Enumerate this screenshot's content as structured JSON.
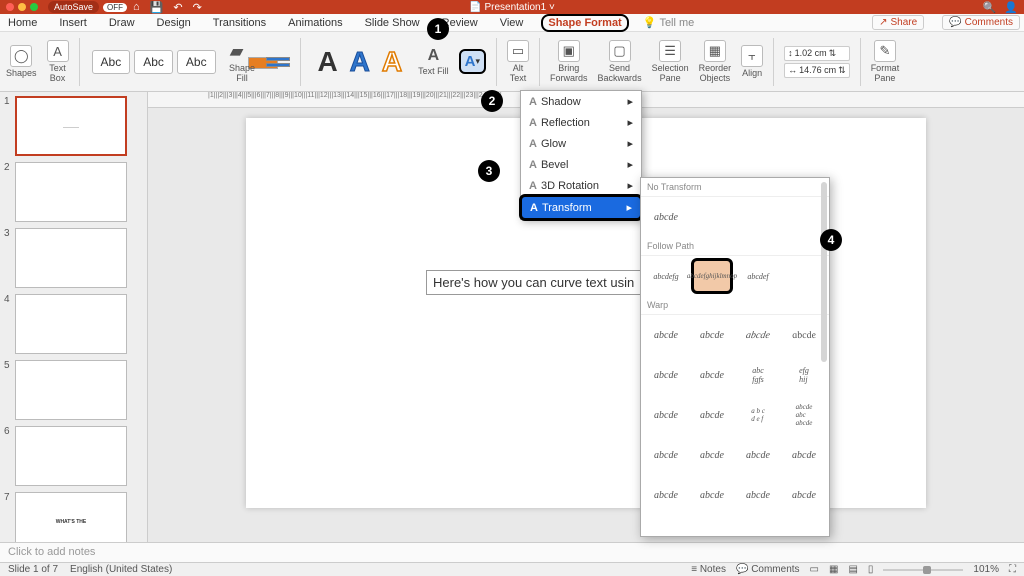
{
  "titlebar": {
    "autosave": "AutoSave",
    "off": "OFF",
    "doc": "Presentation1"
  },
  "tabs": {
    "items": [
      "Home",
      "Insert",
      "Draw",
      "Design",
      "Transitions",
      "Animations",
      "Slide Show",
      "Review",
      "View",
      "Shape Format"
    ],
    "active": "Shape Format",
    "tellme": "Tell me",
    "share": "Share",
    "comments": "Comments"
  },
  "ribbon": {
    "shapes": "Shapes",
    "textbox": "Text\nBox",
    "abc": "Abc",
    "shapefill": "Shape\nFill",
    "textfill": "Text Fill",
    "alttext": "Alt\nText",
    "bringfwd": "Bring\nForwards",
    "sendback": "Send\nBackwards",
    "selpane": "Selection\nPane",
    "reorder": "Reorder\nObjects",
    "align": "Align",
    "width": "1.02 cm",
    "height": "14.76 cm",
    "formatpane": "Format\nPane"
  },
  "dropdown": {
    "items": [
      "Shadow",
      "Reflection",
      "Glow",
      "Bevel",
      "3D Rotation",
      "Transform"
    ],
    "selected": "Transform"
  },
  "gallery": {
    "sections": {
      "notransform": "No Transform",
      "abcde": "abcde",
      "followpath": "Follow Path",
      "warp": "Warp"
    },
    "celltext": "abcde"
  },
  "slide": {
    "textbox": "Here's how you can curve text usin"
  },
  "notes": "Click to add notes",
  "status": {
    "left": "Slide 1 of 7",
    "lang": "English (United States)",
    "notes": "Notes",
    "comments": "Comments",
    "zoom": "101%"
  },
  "thumbs": {
    "count": 7,
    "last_preview": "WHAT'S THE"
  },
  "annotations": {
    "b1": "1",
    "b2": "2",
    "b3": "3",
    "b4": "4"
  }
}
